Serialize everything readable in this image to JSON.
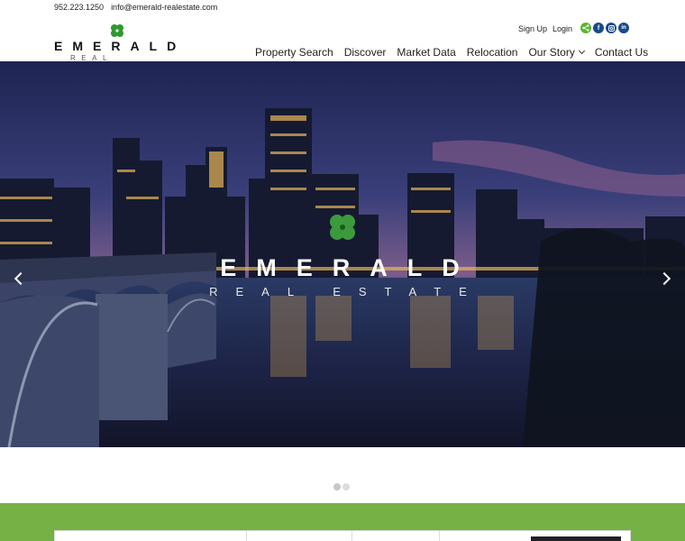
{
  "topbar": {
    "phone": "952.223.1250",
    "email": "info@emerald-realestate.com"
  },
  "brand": {
    "name": "EMERALD",
    "tagline": "REAL ESTATE",
    "accent": "#2e9a2e"
  },
  "auth": {
    "signup": "Sign Up",
    "login": "Login"
  },
  "social": [
    {
      "icon": "share-icon",
      "color": "#5cb531"
    },
    {
      "icon": "facebook-icon",
      "color": "#1a4a8c"
    },
    {
      "icon": "instagram-icon",
      "color": "#1a4a8c"
    },
    {
      "icon": "linkedin-icon",
      "color": "#1a4a8c"
    }
  ],
  "nav": {
    "items": [
      {
        "label": "Property Search"
      },
      {
        "label": "Discover"
      },
      {
        "label": "Market Data"
      },
      {
        "label": "Relocation"
      },
      {
        "label": "Our Story"
      },
      {
        "label": "Contact Us"
      }
    ]
  },
  "hero": {
    "title": "EMERALD",
    "subtitle": "REAL ESTATE"
  },
  "slider": {
    "slide_count": 2,
    "active": 1
  },
  "colors": {
    "band": "#75b145"
  }
}
